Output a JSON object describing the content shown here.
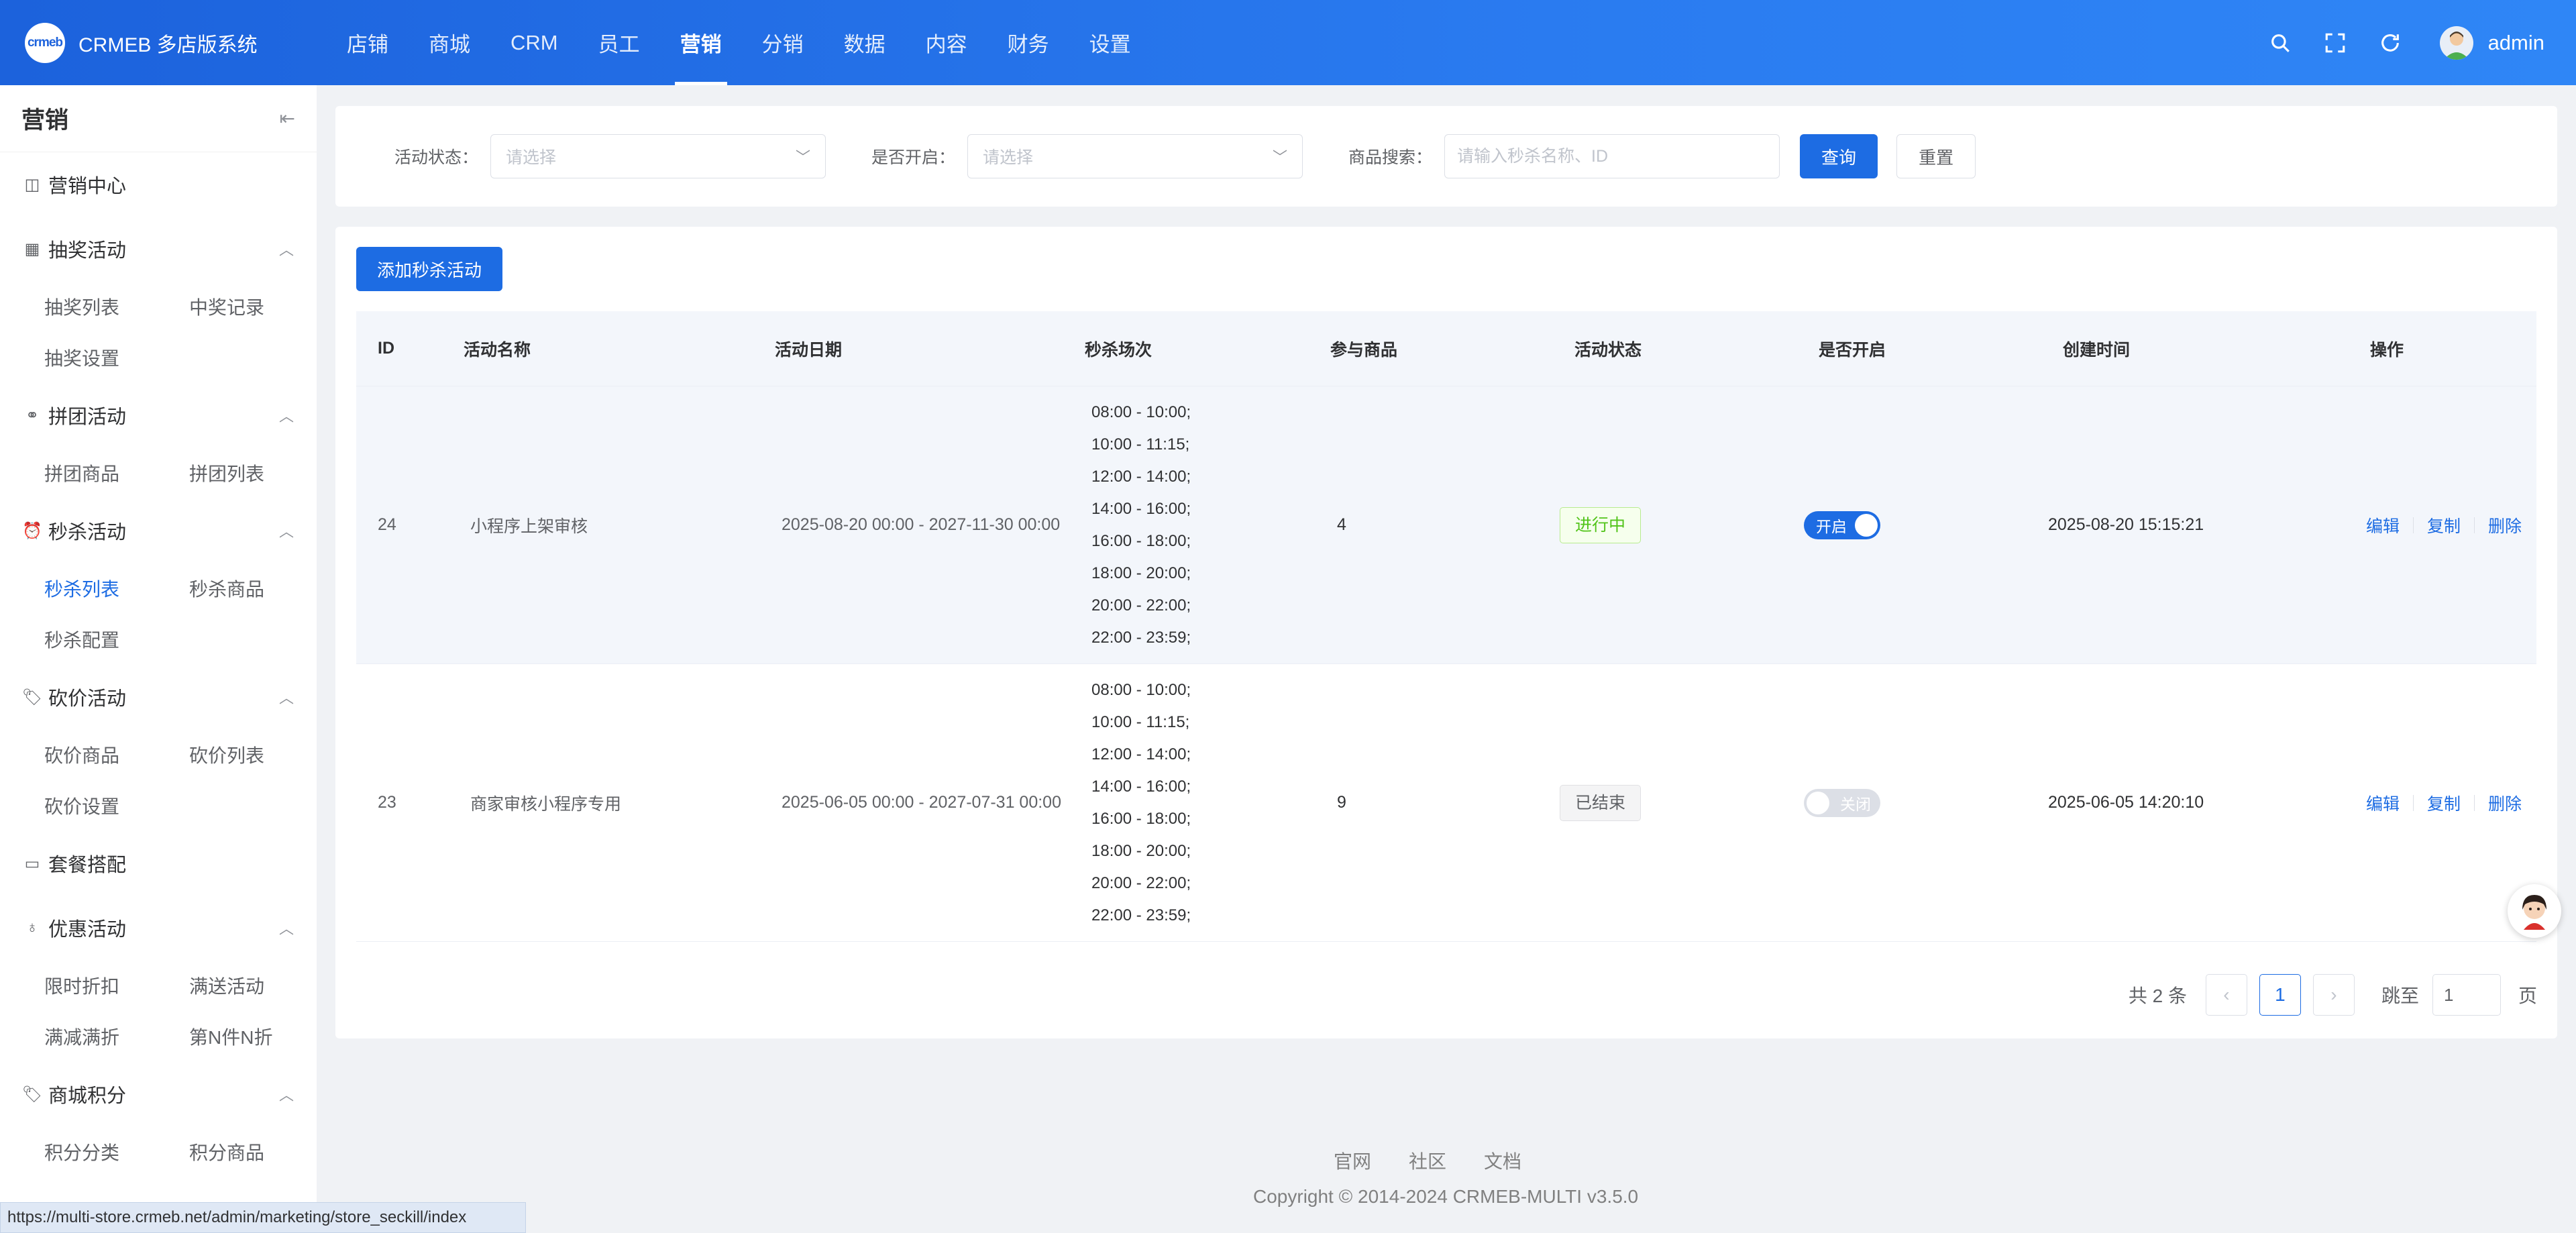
{
  "header": {
    "logo_text": "crmeb",
    "app_title": "CRMEB 多店版系统",
    "nav": [
      "店铺",
      "商城",
      "CRM",
      "员工",
      "营销",
      "分销",
      "数据",
      "内容",
      "财务",
      "设置"
    ],
    "active_nav": "营销",
    "username": "admin"
  },
  "sidebar": {
    "title": "营销",
    "center": "营销中心",
    "groups": [
      {
        "title": "抽奖活动",
        "items": [
          "抽奖列表",
          "中奖记录",
          "抽奖设置"
        ]
      },
      {
        "title": "拼团活动",
        "items": [
          "拼团商品",
          "拼团列表"
        ]
      },
      {
        "title": "秒杀活动",
        "items": [
          "秒杀列表",
          "秒杀商品",
          "秒杀配置"
        ]
      },
      {
        "title": "砍价活动",
        "items": [
          "砍价商品",
          "砍价列表",
          "砍价设置"
        ]
      }
    ],
    "package": "套餐搭配",
    "discount_group": {
      "title": "优惠活动",
      "items": [
        "限时折扣",
        "满送活动",
        "满减满折",
        "第N件N折"
      ]
    },
    "points_group": {
      "title": "商城积分",
      "items": [
        "积分分类",
        "积分商品"
      ]
    },
    "active_item": "秒杀列表"
  },
  "filters": {
    "status_label": "活动状态：",
    "status_placeholder": "请选择",
    "enabled_label": "是否开启：",
    "enabled_placeholder": "请选择",
    "search_label": "商品搜索：",
    "search_placeholder": "请输入秒杀名称、ID",
    "query_btn": "查询",
    "reset_btn": "重置"
  },
  "table": {
    "add_btn": "添加秒杀活动",
    "columns": [
      "ID",
      "活动名称",
      "活动日期",
      "秒杀场次",
      "参与商品",
      "活动状态",
      "是否开启",
      "创建时间",
      "操作"
    ],
    "rows": [
      {
        "id": "24",
        "name": "小程序上架审核",
        "date": "2025-08-20 00:00 - 2027-11-30 00:00",
        "slots": [
          "08:00 - 10:00;",
          "10:00 - 11:15;",
          "12:00 - 14:00;",
          "14:00 - 16:00;",
          "16:00 - 18:00;",
          "18:00 - 20:00;",
          "20:00 - 22:00;",
          "22:00 - 23:59;"
        ],
        "products": "4",
        "status": "进行中",
        "enabled": "开启",
        "created": "2025-08-20 15:15:21"
      },
      {
        "id": "23",
        "name": "商家审核小程序专用",
        "date": "2025-06-05 00:00 - 2027-07-31 00:00",
        "slots": [
          "08:00 - 10:00;",
          "10:00 - 11:15;",
          "12:00 - 14:00;",
          "14:00 - 16:00;",
          "16:00 - 18:00;",
          "18:00 - 20:00;",
          "20:00 - 22:00;",
          "22:00 - 23:59;"
        ],
        "products": "9",
        "status": "已结束",
        "enabled": "关闭",
        "created": "2025-06-05 14:20:10"
      }
    ],
    "ops": [
      "编辑",
      "复制",
      "删除"
    ]
  },
  "pagination": {
    "total": "共 2 条",
    "current": "1",
    "jump_label": "跳至",
    "jump_value": "1",
    "page_suffix": "页"
  },
  "footer": {
    "links": [
      "官网",
      "社区",
      "文档"
    ],
    "copyright": "Copyright © 2014-2024 CRMEB-MULTI v3.5.0"
  },
  "status_url": "https://multi-store.crmeb.net/admin/marketing/store_seckill/index",
  "colors": {
    "primary": "#1d6ce3",
    "header_start": "#1c62dc",
    "header_end": "#2f86f6",
    "success": "#52c41a"
  }
}
